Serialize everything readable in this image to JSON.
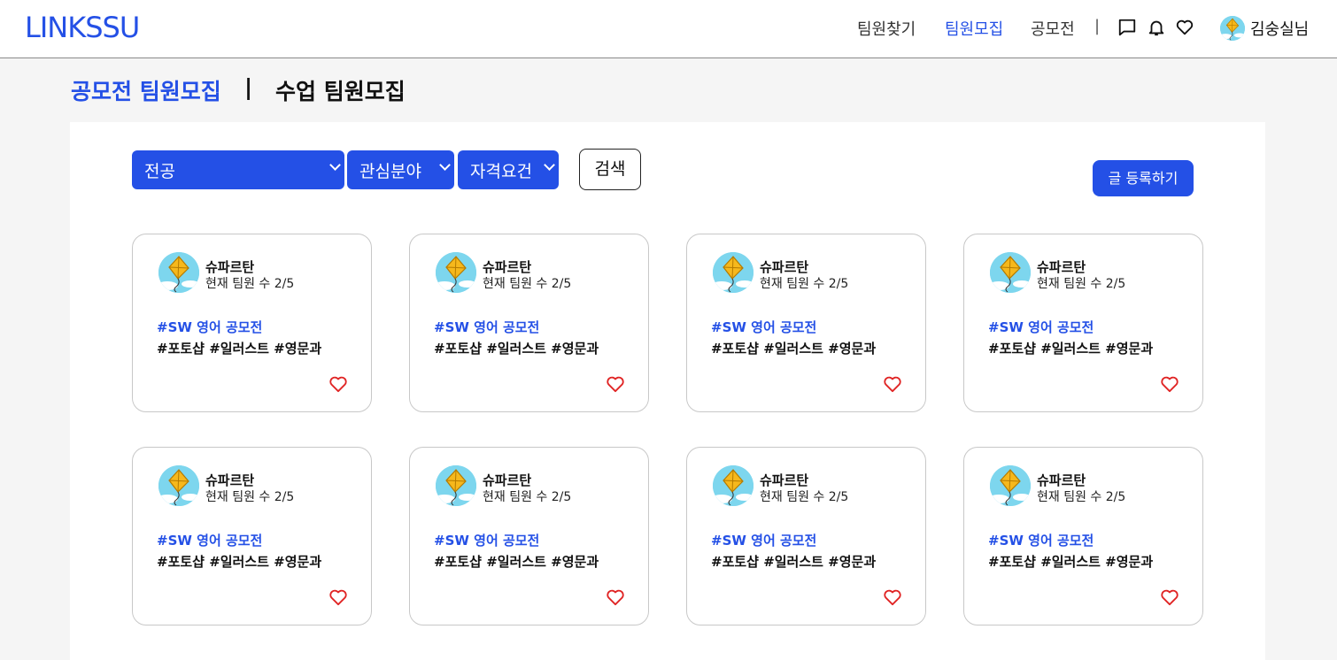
{
  "header": {
    "logo": "LINKSSU",
    "nav": [
      "팀원찾기",
      "팀원모집",
      "공모전"
    ],
    "separator": "|",
    "username": "김숭실님",
    "icons": [
      "chat-icon",
      "bell-icon",
      "heart-icon"
    ]
  },
  "page_tabs": {
    "active": "공모전 팀원모집",
    "separator": "|",
    "other": "수업 팀원모집"
  },
  "filters": {
    "major": "전공",
    "interest": "관심분야",
    "qualification": "자격요건",
    "search": "검색",
    "write": "글 등록하기"
  },
  "colors": {
    "accent": "#2450e6",
    "heart": "#e02424"
  },
  "cards": [
    {
      "name": "슈파르탄",
      "count": "현재 팀원 수 2/5",
      "topic": "#SW 영어 공모전",
      "tags": "#포토샵 #일러스트 #영문과"
    },
    {
      "name": "슈파르탄",
      "count": "현재 팀원 수 2/5",
      "topic": "#SW 영어 공모전",
      "tags": "#포토샵 #일러스트 #영문과"
    },
    {
      "name": "슈파르탄",
      "count": "현재 팀원 수 2/5",
      "topic": "#SW 영어 공모전",
      "tags": "#포토샵 #일러스트 #영문과"
    },
    {
      "name": "슈파르탄",
      "count": "현재 팀원 수 2/5",
      "topic": "#SW 영어 공모전",
      "tags": "#포토샵 #일러스트 #영문과"
    },
    {
      "name": "슈파르탄",
      "count": "현재 팀원 수 2/5",
      "topic": "#SW 영어 공모전",
      "tags": "#포토샵 #일러스트 #영문과"
    },
    {
      "name": "슈파르탄",
      "count": "현재 팀원 수 2/5",
      "topic": "#SW 영어 공모전",
      "tags": "#포토샵 #일러스트 #영문과"
    },
    {
      "name": "슈파르탄",
      "count": "현재 팀원 수 2/5",
      "topic": "#SW 영어 공모전",
      "tags": "#포토샵 #일러스트 #영문과"
    },
    {
      "name": "슈파르탄",
      "count": "현재 팀원 수 2/5",
      "topic": "#SW 영어 공모전",
      "tags": "#포토샵 #일러스트 #영문과"
    }
  ]
}
